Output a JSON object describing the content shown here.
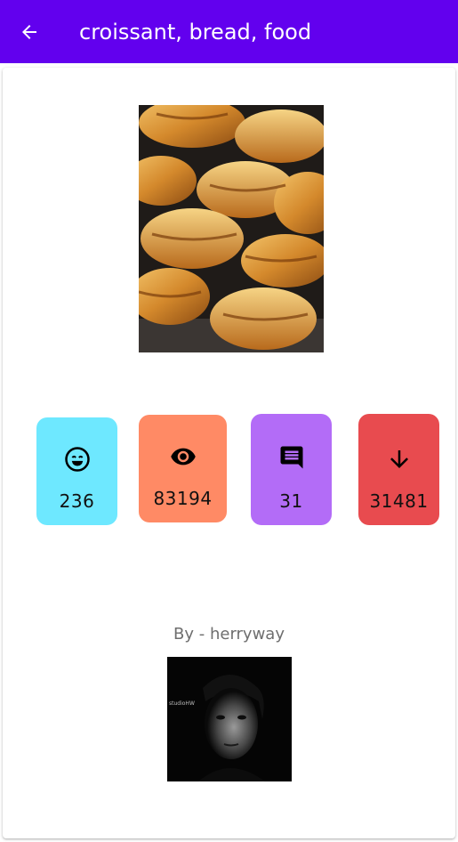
{
  "appbar": {
    "title": "croissant, bread, food",
    "back_icon": "arrow-back-icon",
    "background": "#6200ee"
  },
  "stats": {
    "likes": {
      "icon": "smile-icon",
      "value": "236",
      "color": "#6ee8ff"
    },
    "views": {
      "icon": "eye-icon",
      "value": "83194",
      "color": "#ff8a65"
    },
    "comments": {
      "icon": "comment-icon",
      "value": "31",
      "color": "#b36cf7"
    },
    "downloads": {
      "icon": "arrow-down-icon",
      "value": "31481",
      "color": "#e84b4f"
    }
  },
  "author": {
    "label": "By - herryway",
    "avatar_watermark": "studioHW"
  }
}
